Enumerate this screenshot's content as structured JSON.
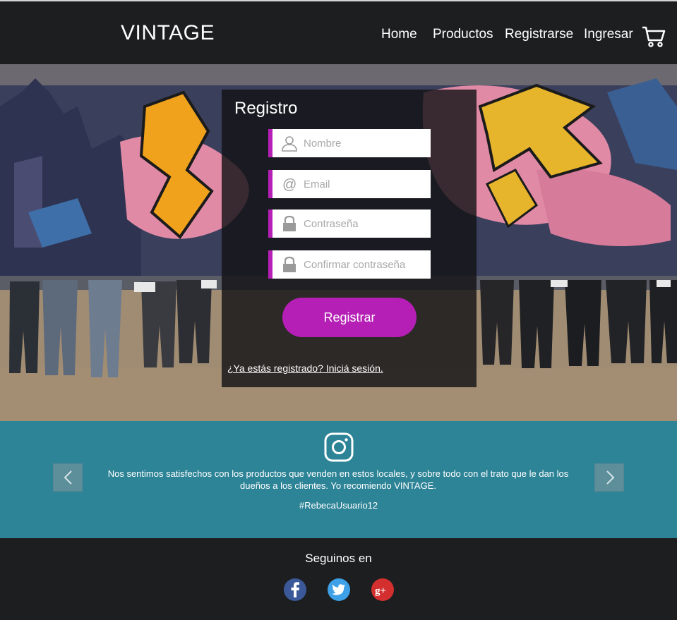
{
  "brand": "VINTAGE",
  "nav": {
    "items": [
      {
        "label": "Home"
      },
      {
        "label": "Productos"
      },
      {
        "label": "Registrarse"
      },
      {
        "label": "Ingresar"
      }
    ],
    "cart_icon": "cart-icon"
  },
  "hero": {
    "background": "graffiti-wall-with-hanging-jeans",
    "colors": {
      "wall_pink": "#e08aa6",
      "wall_yellow": "#e7b52c",
      "wall_orange": "#f0a21d",
      "wall_blue": "#3a5f93"
    }
  },
  "form": {
    "title": "Registro",
    "fields": [
      {
        "placeholder": "Nombre",
        "icon": "user-icon"
      },
      {
        "placeholder": "Email",
        "icon": "at-icon"
      },
      {
        "placeholder": "Contraseña",
        "icon": "lock-icon"
      },
      {
        "placeholder": "Confirmar contraseña",
        "icon": "lock-icon"
      }
    ],
    "submit": "Registrar",
    "login_link": "¿Ya estás registrado? Iniciá sesión.",
    "accent": "#b51fb5"
  },
  "testimonial": {
    "icon": "instagram-icon",
    "quote": "Nos sentimos satisfechos con los productos que venden en estos locales, y sobre todo con el trato que le dan los dueños a los clientes. Yo recomiendo VINTAGE.",
    "handle": "#RebecaUsuario12",
    "bg": "#2e8497"
  },
  "footer": {
    "follow": "Seguinos en",
    "social": [
      {
        "icon": "facebook-icon",
        "color": "#3b5998"
      },
      {
        "icon": "twitter-icon",
        "color": "#3ea0e6"
      },
      {
        "icon": "google-plus-icon",
        "color": "#d32f2f"
      }
    ]
  }
}
